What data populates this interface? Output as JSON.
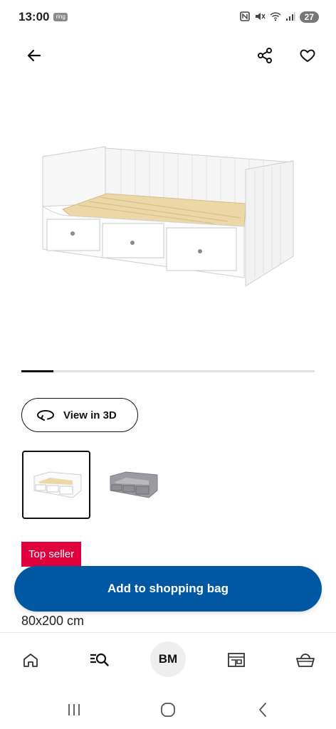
{
  "status_bar": {
    "time": "13:00",
    "ring_label": "ring",
    "battery": "27"
  },
  "app_bar": {
    "back_icon": "arrow-left-icon",
    "share_icon": "share-icon",
    "favorite_icon": "heart-icon"
  },
  "gallery": {
    "progress_fraction": 0.11,
    "view3d_label": "View in 3D",
    "view3d_icon": "rotate-3d-icon"
  },
  "variants": [
    {
      "color": "#ffffff",
      "selected": true
    },
    {
      "color": "#8e8e92",
      "selected": false
    }
  ],
  "product": {
    "badge": "Top seller",
    "size": "80x200 cm"
  },
  "cta": {
    "add_label": "Add to shopping bag"
  },
  "bottom_nav": {
    "home_icon": "home-icon",
    "search_icon": "search-list-icon",
    "avatar_initials": "BM",
    "store_icon": "store-icon",
    "basket_icon": "basket-icon"
  },
  "colors": {
    "accent": "#0058a3",
    "badge": "#e0003d"
  }
}
